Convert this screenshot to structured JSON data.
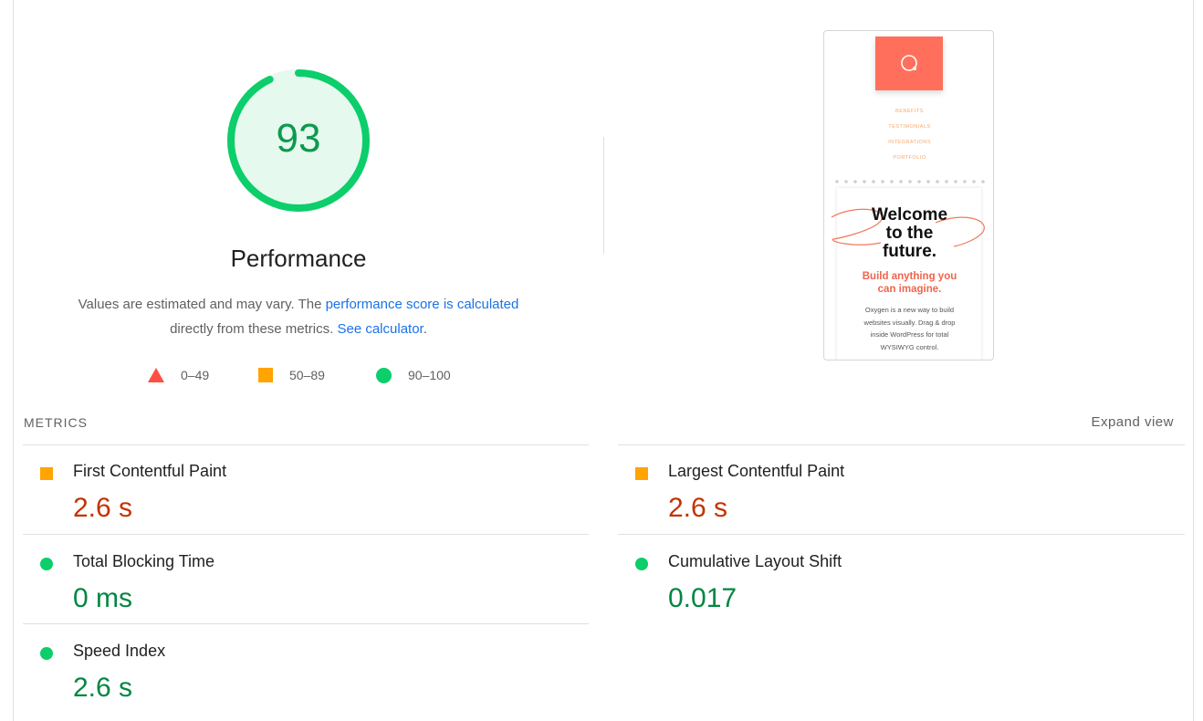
{
  "score": {
    "value": "93",
    "fraction": 0.93,
    "title": "Performance"
  },
  "description": {
    "text1": "Values are estimated and may vary. The ",
    "link1": "performance score is calculated",
    "text2": "directly from these metrics. ",
    "link2": "See calculator",
    "text3": "."
  },
  "legend": [
    {
      "icon": "red-triangle-icon",
      "label": "0–49"
    },
    {
      "icon": "orange-square-icon",
      "label": "50–89"
    },
    {
      "icon": "green-circle-icon",
      "label": "90–100"
    }
  ],
  "screenshot": {
    "nav": [
      "BENEFITS",
      "TESTIMONIALS",
      "INTEGRATIONS",
      "PORTFOLIO"
    ],
    "headline": [
      "Welcome",
      "to the",
      "future."
    ],
    "subheadline": [
      "Build anything you",
      "can imagine."
    ],
    "body": [
      "Oxygen is a new way to build",
      "websites visually. Drag & drop",
      "inside WordPress for total",
      "WYSIWYG control."
    ]
  },
  "metrics_header": "METRICS",
  "expand_label": "Expand view",
  "metrics": {
    "fcp": {
      "name": "First Contentful Paint",
      "value": "2.6 s",
      "rating": "average"
    },
    "lcp": {
      "name": "Largest Contentful Paint",
      "value": "2.6 s",
      "rating": "average"
    },
    "tbt": {
      "name": "Total Blocking Time",
      "value": "0 ms",
      "rating": "pass"
    },
    "cls": {
      "name": "Cumulative Layout Shift",
      "value": "0.017",
      "rating": "pass"
    },
    "si": {
      "name": "Speed Index",
      "value": "2.6 s",
      "rating": "pass"
    }
  },
  "colors": {
    "pass": "#0cce6b",
    "average": "#ffa400",
    "fail": "#ff4e42",
    "pass_text": "#018642",
    "average_text": "#c33300",
    "link": "#1a73e8"
  }
}
